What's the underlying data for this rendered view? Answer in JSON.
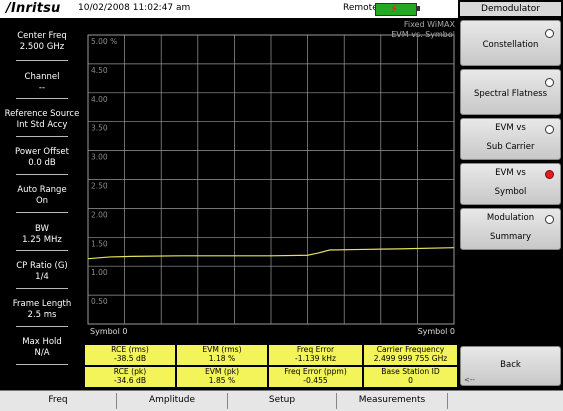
{
  "topbar": {
    "brand": "/Inritsu",
    "datetime": "10/02/2008 11:02:47 am",
    "remote": "Remote",
    "battery_icon": "battery-charging-icon"
  },
  "left_panel": [
    {
      "label": "Center Freq",
      "value": "2.500 GHz"
    },
    {
      "label": "Channel",
      "value": "--"
    },
    {
      "label": "Reference Source",
      "value": "Int Std Accy"
    },
    {
      "label": "Power Offset",
      "value": "0.0 dB"
    },
    {
      "label": "Auto Range",
      "value": "On"
    },
    {
      "label": "BW",
      "value": "1.25 MHz"
    },
    {
      "label": "CP Ratio (G)",
      "value": "1/4"
    },
    {
      "label": "Frame Length",
      "value": "2.5 ms"
    },
    {
      "label": "Max Hold",
      "value": "N/A"
    }
  ],
  "plot": {
    "title_line1": "Fixed WiMAX",
    "title_line2": "EVM vs. Symbol",
    "x_left_label": "Symbol  0",
    "x_right_label": "Symbol  0"
  },
  "chart_data": {
    "type": "line",
    "yticks": [
      "5.00 %",
      "4.50",
      "4.00",
      "3.50",
      "3.00",
      "2.50",
      "2.00",
      "1.50",
      "1.00",
      "0.50"
    ],
    "ylim": [
      0,
      5
    ],
    "series": [
      {
        "x": [
          0,
          0.06,
          0.12,
          0.25,
          0.5,
          0.6,
          0.63,
          0.66,
          0.75,
          0.85,
          1.0
        ],
        "values": [
          1.13,
          1.16,
          1.17,
          1.18,
          1.18,
          1.19,
          1.23,
          1.28,
          1.29,
          1.3,
          1.32
        ]
      }
    ],
    "grid": true,
    "colors": {
      "line": "#e8e060",
      "grid": "#9a9a9a"
    }
  },
  "measurements": {
    "row1": [
      {
        "label": "RCE (rms)",
        "value": "-38.5 dB"
      },
      {
        "label": "EVM (rms)",
        "value": "1.18 %"
      },
      {
        "label": "Freq Error",
        "value": "-1.139 kHz"
      },
      {
        "label": "Carrier Frequency",
        "value": "2.499 999 755 GHz"
      }
    ],
    "row2": [
      {
        "label": "RCE (pk)",
        "value": "-34.6 dB"
      },
      {
        "label": "EVM (pk)",
        "value": "1.85 %"
      },
      {
        "label": "Freq Error (ppm)",
        "value": "-0.455"
      },
      {
        "label": "Base Station ID",
        "value": "0"
      }
    ]
  },
  "right_panel": {
    "header": "Demodulator",
    "buttons": [
      {
        "line1": "Constellation",
        "line2": "",
        "selected": false
      },
      {
        "line1": "Spectral Flatness",
        "line2": "",
        "selected": false
      },
      {
        "line1": "EVM vs",
        "line2": "Sub Carrier",
        "selected": false
      },
      {
        "line1": "EVM vs",
        "line2": "Symbol",
        "selected": true
      },
      {
        "line1": "Modulation",
        "line2": "Summary",
        "selected": false
      }
    ],
    "back": "Back",
    "back_arrow": "<--"
  },
  "bottom_menu": [
    "Freq",
    "Amplitude",
    "Setup",
    "Measurements"
  ],
  "colors": {
    "highlight": "#f3f35a",
    "accent_red": "#e02020",
    "battery": "#22aa22"
  }
}
